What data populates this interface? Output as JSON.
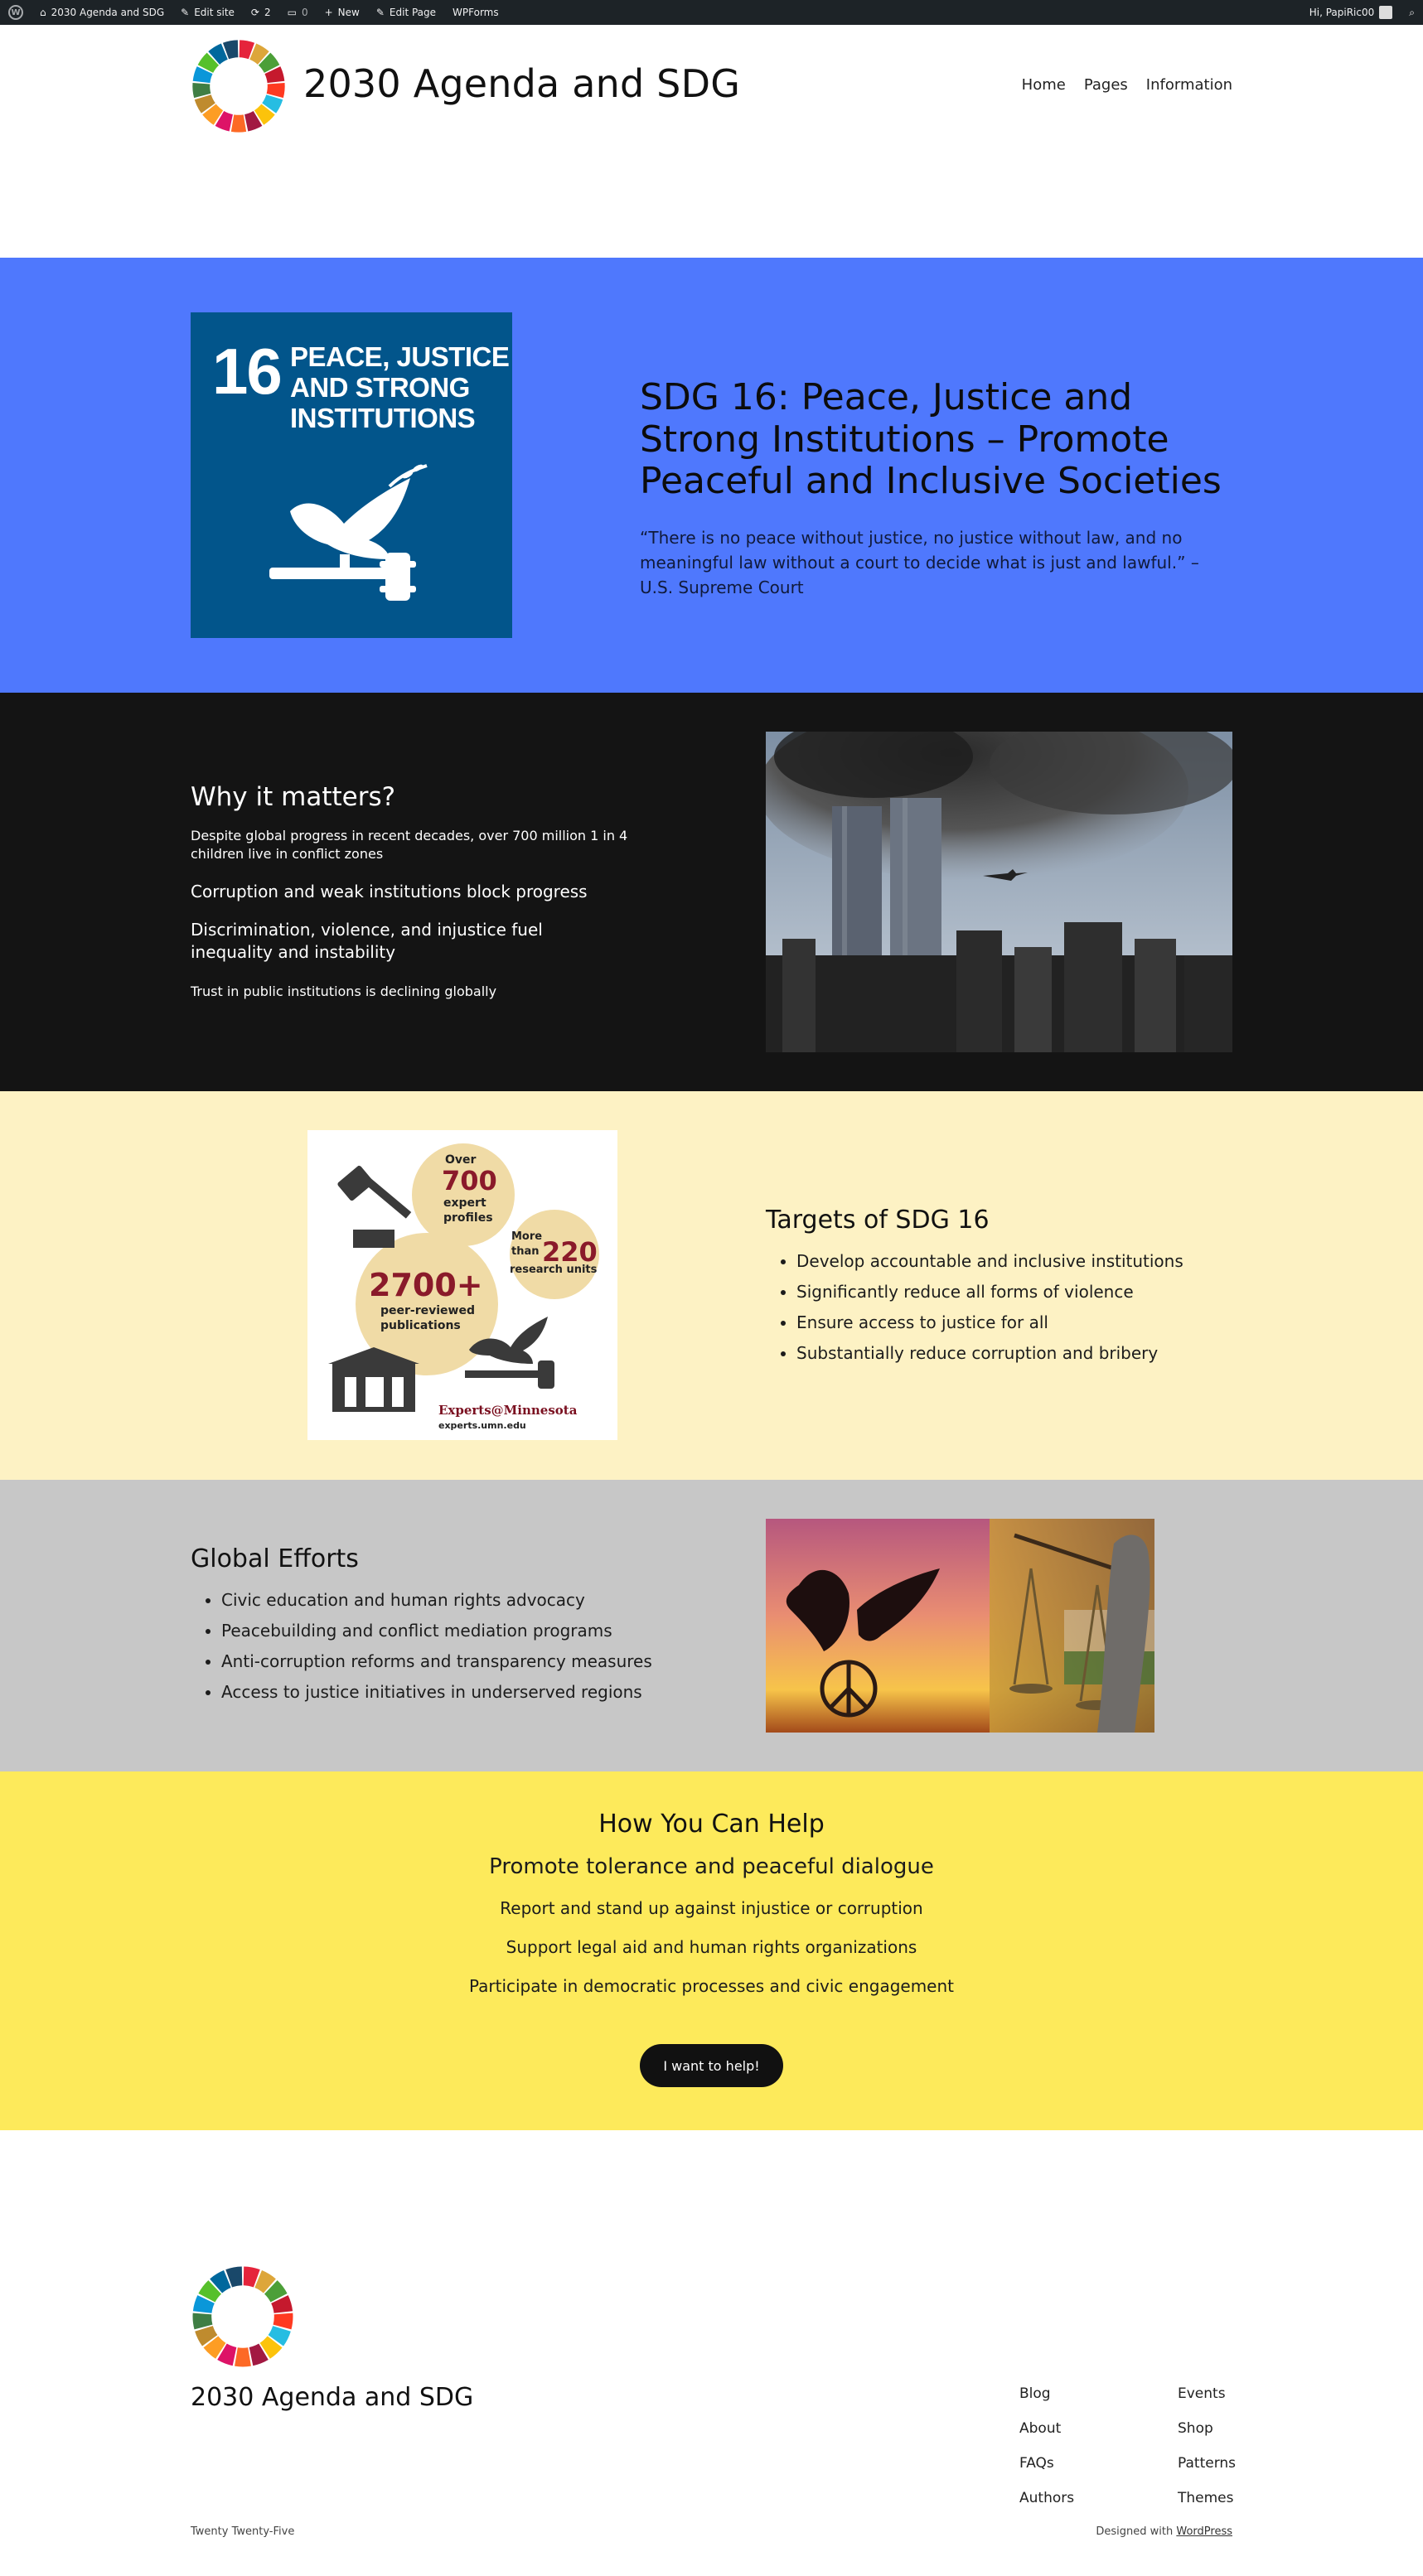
{
  "adminbar": {
    "site": "2030 Agenda and SDG",
    "edit_site": "Edit site",
    "updates": "2",
    "comments": "0",
    "new": "New",
    "edit_page": "Edit Page",
    "wpforms": "WPForms",
    "greeting": "Hi, PapiRic00"
  },
  "header": {
    "title": "2030 Agenda and SDG",
    "nav": [
      "Home",
      "Pages",
      "Information"
    ]
  },
  "hero": {
    "tile_number": "16",
    "tile_name": "PEACE, JUSTICE\nAND STRONG\nINSTITUTIONS",
    "title": "SDG 16: Peace, Justice and Strong Institutions – Promote Peaceful and Inclusive Societies",
    "quote": "“There is no peace without justice, no justice without law, and no meaningful law without a court to decide what is just and lawful.” – U.S. Supreme Court",
    "color": "#4f78fd",
    "tile_color": "#02558b"
  },
  "why": {
    "heading": "Why it matters?",
    "items": [
      "Despite global progress in recent decades, over 700 million 1 in 4 children live in conflict zones",
      "Corruption and weak institutions block progress",
      "Discrimination, violence, and injustice fuel inequality and instability",
      "Trust in public institutions is declining globally"
    ]
  },
  "experts_graphic": {
    "over": "Over",
    "n700": "700",
    "expert": "expert",
    "profiles": "profiles",
    "more": "More",
    "than": "than",
    "n220": "220",
    "research_units": "research units",
    "n2700": "2700+",
    "peer_reviewed": "peer-reviewed",
    "publications": "publications",
    "brand": "Experts@Minnesota",
    "url": "experts.umn.edu"
  },
  "targets": {
    "heading": "Targets of SDG 16",
    "items": [
      "Develop accountable and inclusive institutions",
      "Significantly reduce all forms of violence",
      "Ensure access to justice for all",
      "Substantially reduce corruption and bribery"
    ]
  },
  "global": {
    "heading": "Global Efforts",
    "items": [
      "Civic education and human rights advocacy",
      "Peacebuilding and conflict mediation programs",
      "Anti-corruption reforms and transparency measures",
      "Access to justice initiatives in underserved regions"
    ]
  },
  "help": {
    "heading": "How You Can Help",
    "lines": [
      "Promote tolerance and peaceful dialogue",
      "Report and stand up against injustice or corruption",
      "Support legal aid and human rights organizations",
      "Participate in democratic processes and civic engagement"
    ],
    "button": "I want to help!"
  },
  "footer": {
    "title": "2030 Agenda and SDG",
    "col1": [
      "Blog",
      "About",
      "FAQs",
      "Authors"
    ],
    "col2": [
      "Events",
      "Shop",
      "Patterns",
      "Themes"
    ],
    "theme": "Twenty Twenty-Five",
    "designed_with": "Designed with",
    "wordpress": "WordPress"
  }
}
